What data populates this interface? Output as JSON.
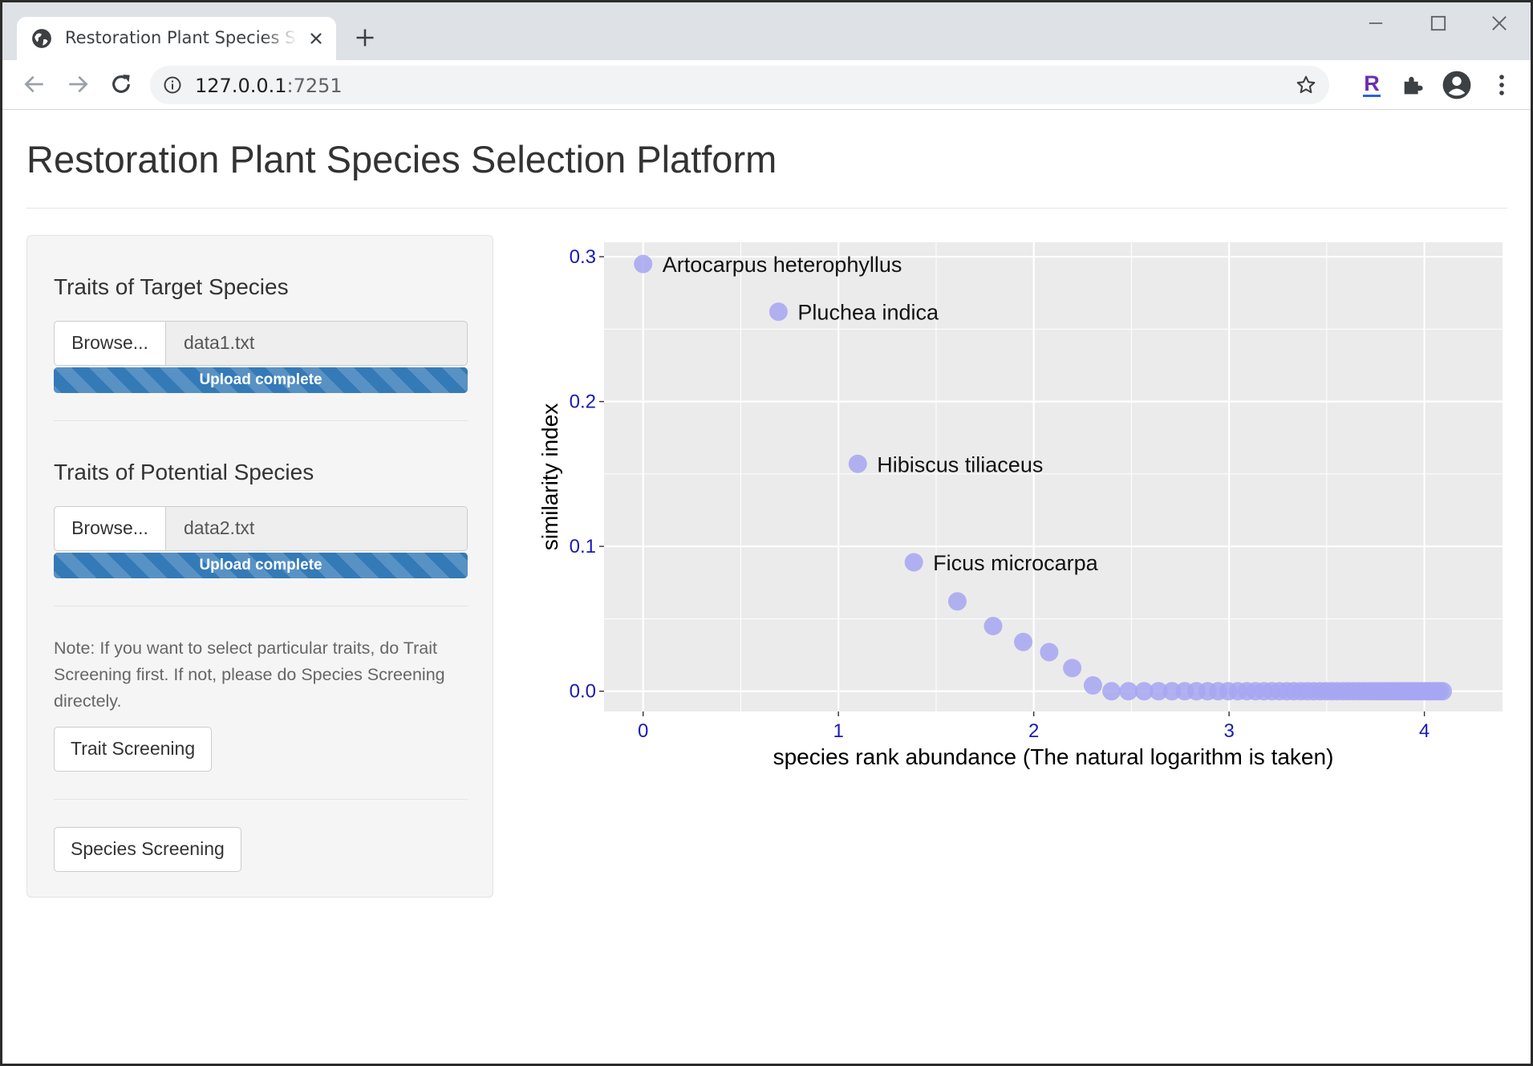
{
  "browser": {
    "tab_title": "Restoration Plant Species Selection Platform",
    "url_host": "127.0.0.1",
    "url_port": ":7251",
    "new_tab_glyph": "+"
  },
  "page": {
    "title": "Restoration Plant Species Selection Platform"
  },
  "sidebar": {
    "target": {
      "label": "Traits of Target Species",
      "browse_label": "Browse...",
      "file_name": "data1.txt",
      "progress_text": "Upload complete",
      "progress_percent": 100
    },
    "potential": {
      "label": "Traits of Potential Species",
      "browse_label": "Browse...",
      "file_name": "data2.txt",
      "progress_text": "Upload complete",
      "progress_percent": 100
    },
    "note": "Note: If you want to select particular traits, do Trait Screening first. If not, please do Species Screening directely.",
    "trait_screening_label": "Trait Screening",
    "species_screening_label": "Species Screening"
  },
  "icons": {
    "tab": "globe-icon",
    "close": "close-icon",
    "back": "back-arrow-icon",
    "forward": "forward-arrow-icon",
    "reload": "reload-icon",
    "info": "info-icon",
    "star": "star-icon",
    "extension": "puzzle-icon",
    "profile": "account-icon",
    "menu": "kebab-menu-icon"
  },
  "colors": {
    "panel_bg": "#ebebeb",
    "point": "#a6a6f2",
    "tick_label": "#1a1ab4",
    "progress": "#337ab7"
  },
  "chart_data": {
    "type": "scatter",
    "title": "",
    "xlabel": "species rank abundance (The natural logarithm is taken)",
    "ylabel": "similarity index",
    "xlim": [
      -0.2,
      4.4
    ],
    "ylim": [
      -0.014,
      0.31
    ],
    "xticks": [
      0,
      1,
      2,
      3,
      4
    ],
    "yticks": [
      0.0,
      0.1,
      0.2,
      0.3
    ],
    "xtick_labels": [
      "0",
      "1",
      "2",
      "3",
      "4"
    ],
    "ytick_labels": [
      "0.0",
      "0.1",
      "0.2",
      "0.3"
    ],
    "grid": true,
    "points": [
      {
        "x": 0.0,
        "y": 0.295,
        "label": "Artocarpus heterophyllus"
      },
      {
        "x": 0.693,
        "y": 0.262,
        "label": "Pluchea indica"
      },
      {
        "x": 1.099,
        "y": 0.157,
        "label": "Hibiscus tiliaceus"
      },
      {
        "x": 1.386,
        "y": 0.089,
        "label": "Ficus microcarpa"
      },
      {
        "x": 1.609,
        "y": 0.062
      },
      {
        "x": 1.792,
        "y": 0.045
      },
      {
        "x": 1.946,
        "y": 0.034
      },
      {
        "x": 2.079,
        "y": 0.027
      },
      {
        "x": 2.197,
        "y": 0.016
      },
      {
        "x": 2.303,
        "y": 0.004
      },
      {
        "x": 2.398,
        "y": 0.0
      },
      {
        "x": 2.485,
        "y": 0.0
      },
      {
        "x": 2.565,
        "y": 0.0
      },
      {
        "x": 2.639,
        "y": 0.0
      },
      {
        "x": 2.708,
        "y": 0.0
      },
      {
        "x": 2.773,
        "y": 0.0
      },
      {
        "x": 2.833,
        "y": 0.0
      },
      {
        "x": 2.89,
        "y": 0.0
      },
      {
        "x": 2.944,
        "y": 0.0
      },
      {
        "x": 2.996,
        "y": 0.0
      },
      {
        "x": 3.045,
        "y": 0.0
      },
      {
        "x": 3.091,
        "y": 0.0
      },
      {
        "x": 3.135,
        "y": 0.0
      },
      {
        "x": 3.178,
        "y": 0.0
      },
      {
        "x": 3.219,
        "y": 0.0
      },
      {
        "x": 3.258,
        "y": 0.0
      },
      {
        "x": 3.296,
        "y": 0.0
      },
      {
        "x": 3.332,
        "y": 0.0
      },
      {
        "x": 3.367,
        "y": 0.0
      },
      {
        "x": 3.401,
        "y": 0.0
      },
      {
        "x": 3.434,
        "y": 0.0
      },
      {
        "x": 3.466,
        "y": 0.0
      },
      {
        "x": 3.497,
        "y": 0.0
      },
      {
        "x": 3.526,
        "y": 0.0
      },
      {
        "x": 3.555,
        "y": 0.0
      },
      {
        "x": 3.584,
        "y": 0.0
      },
      {
        "x": 3.611,
        "y": 0.0
      },
      {
        "x": 3.638,
        "y": 0.0
      },
      {
        "x": 3.664,
        "y": 0.0
      },
      {
        "x": 3.689,
        "y": 0.0
      },
      {
        "x": 3.714,
        "y": 0.0
      },
      {
        "x": 3.738,
        "y": 0.0
      },
      {
        "x": 3.761,
        "y": 0.0
      },
      {
        "x": 3.784,
        "y": 0.0
      },
      {
        "x": 3.807,
        "y": 0.0
      },
      {
        "x": 3.829,
        "y": 0.0
      },
      {
        "x": 3.85,
        "y": 0.0
      },
      {
        "x": 3.871,
        "y": 0.0
      },
      {
        "x": 3.892,
        "y": 0.0
      },
      {
        "x": 3.912,
        "y": 0.0
      },
      {
        "x": 3.932,
        "y": 0.0
      },
      {
        "x": 3.951,
        "y": 0.0
      },
      {
        "x": 3.97,
        "y": 0.0
      },
      {
        "x": 3.989,
        "y": 0.0
      },
      {
        "x": 4.007,
        "y": 0.0
      },
      {
        "x": 4.025,
        "y": 0.0
      },
      {
        "x": 4.043,
        "y": 0.0
      },
      {
        "x": 4.06,
        "y": 0.0
      },
      {
        "x": 4.078,
        "y": 0.0
      },
      {
        "x": 4.094,
        "y": 0.0
      }
    ]
  }
}
